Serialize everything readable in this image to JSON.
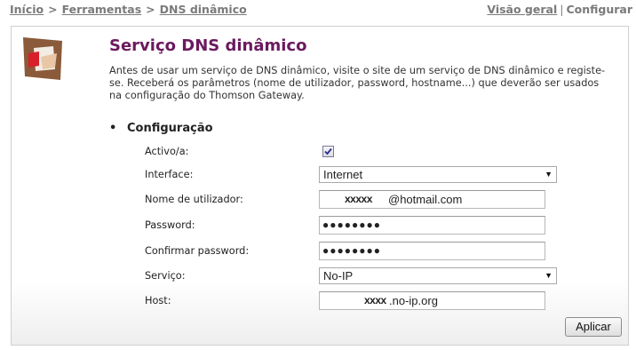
{
  "breadcrumb": {
    "home": "Início",
    "tools": "Ferramentas",
    "current": "DNS dinâmico",
    "separator": ">"
  },
  "viewnav": {
    "overview": "Visão geral",
    "separator": "|",
    "configure": "Configurar"
  },
  "page": {
    "title": "Serviço DNS dinâmico",
    "description": "Antes de usar um serviço de DNS dinâmico, visite o site de um serviço de DNS dinâmico e registe-se. Receberá os parâmetros (nome de utilizador, password, hostname...) que deverão ser usados na configuração do Thomson Gateway."
  },
  "config": {
    "section_title": "Configuração",
    "bullet": "•",
    "active": {
      "label": "Activo/a:",
      "checked": true
    },
    "interface": {
      "label": "Interface:",
      "value": "Internet"
    },
    "username": {
      "label": "Nome de utilizador:",
      "masked": "xxxxx",
      "domain": "@hotmail.com"
    },
    "password": {
      "label": "Password:",
      "value": "●●●●●●●●"
    },
    "confirm": {
      "label": "Confirmar password:",
      "value": "●●●●●●●●"
    },
    "service": {
      "label": "Serviço:",
      "value": "No-IP"
    },
    "host": {
      "label": "Host:",
      "masked": "xxxx",
      "domain": ".no-ip.org"
    }
  },
  "apply_label": "Aplicar",
  "icons": {
    "dropdown": "chevron-down-icon",
    "checkbox": "checkmark-icon",
    "logo": "thomson-logo"
  },
  "colors": {
    "title": "#6b1a5f",
    "link": "#7a7a7a"
  }
}
